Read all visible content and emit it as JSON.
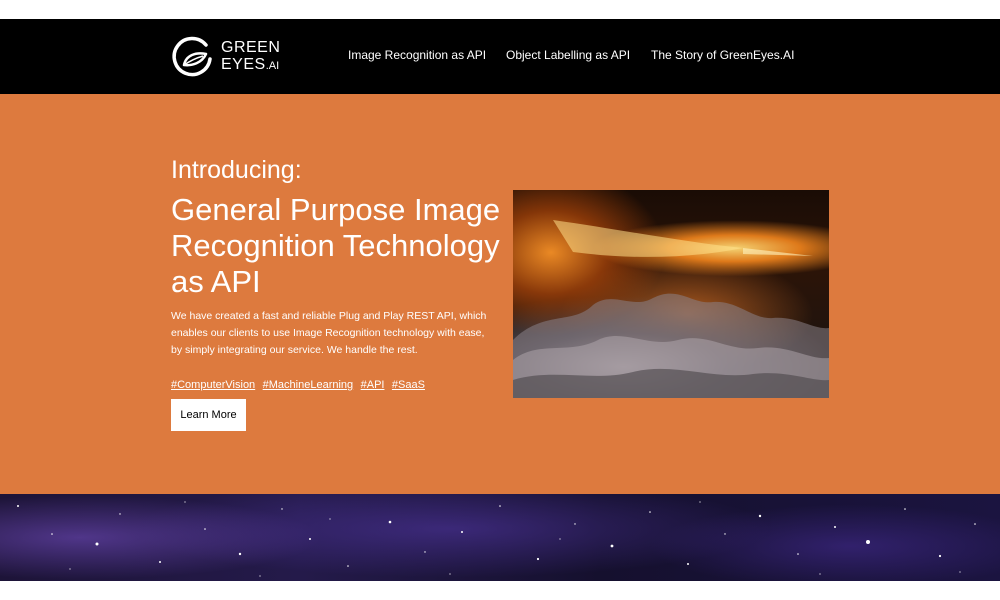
{
  "brand": {
    "line1": "GREEN",
    "line2": "EYES",
    "suffix": ".AI"
  },
  "nav": {
    "items": [
      {
        "label": "Image Recognition as API"
      },
      {
        "label": "Object Labelling as API"
      },
      {
        "label": "The Story of GreenEyes.AI"
      }
    ]
  },
  "hero": {
    "intro": "Introducing:",
    "headline": "General Purpose Image Recognition Technology as API",
    "description": "We have created a fast and reliable Plug and Play REST API, which enables our clients to use Image Recognition technology with ease, by simply integrating our service. We handle the rest.",
    "tags": [
      "#ComputerVision",
      "#MachineLearning",
      "#API",
      "#SaaS"
    ],
    "cta_label": "Learn More"
  },
  "colors": {
    "navbar_bg": "#000000",
    "hero_bg": "#dd7a3e",
    "text": "#ffffff",
    "button_bg": "#ffffff"
  }
}
